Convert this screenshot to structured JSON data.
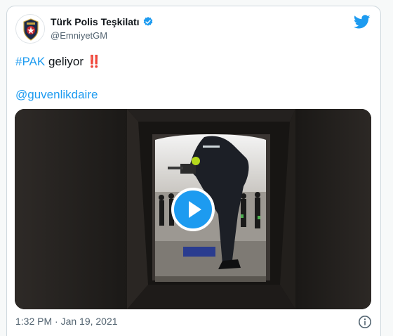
{
  "tweet": {
    "display_name": "Türk Polis Teşkilatı",
    "handle": "@EmniyetGM",
    "verified": true,
    "text_hashtag": "#PAK",
    "text_body": " geliyor",
    "text_emoji": "‼️",
    "mention": "@guvenlikdaire",
    "timestamp": "1:32 PM · Jan 19, 2021"
  },
  "media": {
    "type": "video",
    "play_icon": "play-icon"
  },
  "icons": {
    "brand": "twitter-bird-icon",
    "verified": "verified-badge-icon",
    "info": "info-icon"
  },
  "colors": {
    "accent": "#1d9bf0",
    "text": "#0f1419",
    "secondary": "#536471"
  }
}
